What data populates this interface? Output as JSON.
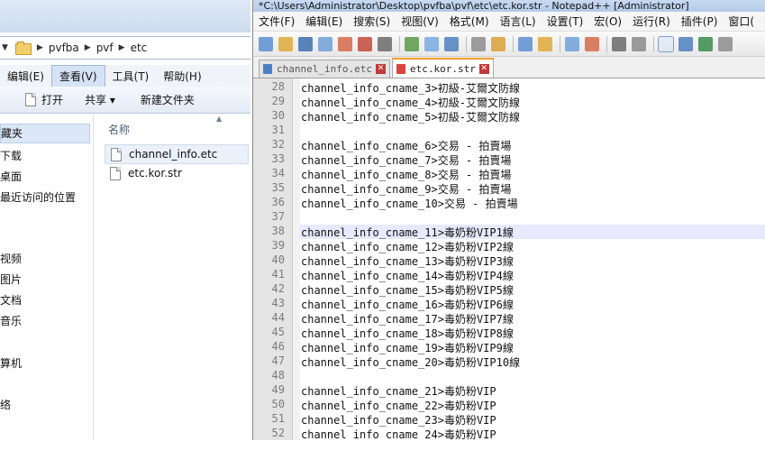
{
  "explorer": {
    "address": {
      "segments": [
        "pvfba",
        "pvf",
        "etc"
      ]
    },
    "menu": [
      "编辑(E)",
      "查看(V)",
      "工具(T)",
      "帮助(H)"
    ],
    "commands": {
      "open": "打开",
      "share": "共享 ▾",
      "new_folder": "新建文件夹"
    },
    "nav_items": [
      "藏夹",
      "下载",
      "桌面",
      "最近访问的位置",
      "视频",
      "图片",
      "文档",
      "音乐",
      "算机",
      "络"
    ],
    "files_header": "名称",
    "files": [
      "channel_info.etc",
      "etc.kor.str"
    ]
  },
  "npp": {
    "title": "*C:\\Users\\Administrator\\Desktop\\pvfba\\pvf\\etc\\etc.kor.str - Notepad++ [Administrator]",
    "menu": [
      "文件(F)",
      "编辑(E)",
      "搜索(S)",
      "视图(V)",
      "格式(M)",
      "语言(L)",
      "设置(T)",
      "宏(O)",
      "运行(R)",
      "插件(P)",
      "窗口("
    ],
    "tabs": [
      {
        "label": "channel_info.etc",
        "active": false
      },
      {
        "label": "etc.kor.str",
        "active": true
      }
    ],
    "toolbar_icons": [
      "new-icon",
      "open-icon",
      "save-icon",
      "save-all-icon",
      "close-icon",
      "close-all-icon",
      "print-icon",
      "sep",
      "cut-icon",
      "copy-icon",
      "paste-icon",
      "sep",
      "undo-icon",
      "redo-icon",
      "sep",
      "find-icon",
      "replace-icon",
      "sep",
      "zoom-in-icon",
      "zoom-out-icon",
      "sep",
      "sync-v-icon",
      "sync-h-icon",
      "sep",
      "word-wrap-icon",
      "show-all-chars-icon",
      "indent-guide-icon",
      "user-lang-icon"
    ],
    "current_line": 38,
    "lines": [
      {
        "n": "28",
        "t": "channel_info_cname_3>初級-艾爾文防線"
      },
      {
        "n": "29",
        "t": "channel_info_cname_4>初級-艾爾文防線"
      },
      {
        "n": "30",
        "t": "channel_info_cname_5>初級-艾爾文防線"
      },
      {
        "n": "31",
        "t": ""
      },
      {
        "n": "32",
        "t": "channel_info_cname_6>交易 - 拍賣場"
      },
      {
        "n": "33",
        "t": "channel_info_cname_7>交易 - 拍賣場"
      },
      {
        "n": "34",
        "t": "channel_info_cname_8>交易 - 拍賣場"
      },
      {
        "n": "35",
        "t": "channel_info_cname_9>交易 - 拍賣場"
      },
      {
        "n": "36",
        "t": "channel_info_cname_10>交易 - 拍賣場"
      },
      {
        "n": "37",
        "t": ""
      },
      {
        "n": "38",
        "t": "channel_info_cname_11>毒奶粉VIP1線"
      },
      {
        "n": "39",
        "t": "channel_info_cname_12>毒奶粉VIP2線"
      },
      {
        "n": "40",
        "t": "channel_info_cname_13>毒奶粉VIP3線"
      },
      {
        "n": "41",
        "t": "channel_info_cname_14>毒奶粉VIP4線"
      },
      {
        "n": "42",
        "t": "channel_info_cname_15>毒奶粉VIP5線"
      },
      {
        "n": "43",
        "t": "channel_info_cname_16>毒奶粉VIP6線"
      },
      {
        "n": "44",
        "t": "channel_info_cname_17>毒奶粉VIP7線"
      },
      {
        "n": "45",
        "t": "channel_info_cname_18>毒奶粉VIP8線"
      },
      {
        "n": "46",
        "t": "channel_info_cname_19>毒奶粉VIP9線"
      },
      {
        "n": "47",
        "t": "channel_info_cname_20>毒奶粉VIP10線"
      },
      {
        "n": "48",
        "t": ""
      },
      {
        "n": "49",
        "t": "channel_info_cname_21>毒奶粉VIP"
      },
      {
        "n": "50",
        "t": "channel_info_cname_22>毒奶粉VIP"
      },
      {
        "n": "51",
        "t": "channel_info_cname_23>毒奶粉VIP"
      },
      {
        "n": "52",
        "t": "channel_info_cname_24>毒奶粉VIP"
      }
    ]
  }
}
